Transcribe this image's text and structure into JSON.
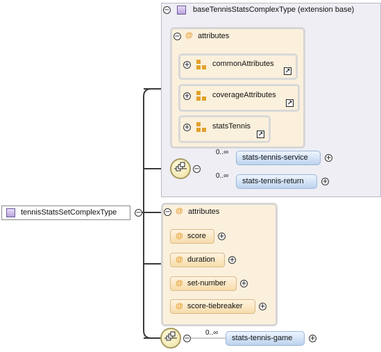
{
  "root": {
    "label": "tennisStatsSetComplexType"
  },
  "extension": {
    "label": "baseTennisStatsComplexType (extension base)",
    "attributes_label": "attributes",
    "groups": [
      {
        "label": "commonAttributes"
      },
      {
        "label": "coverageAttributes"
      },
      {
        "label": "statsTennis"
      }
    ],
    "sequence": [
      {
        "label": "stats-tennis-service",
        "card": "0..∞"
      },
      {
        "label": "stats-tennis-return",
        "card": "0..∞"
      }
    ]
  },
  "attributes": {
    "label": "attributes",
    "items": [
      {
        "label": "score"
      },
      {
        "label": "duration"
      },
      {
        "label": "set-number"
      },
      {
        "label": "score-tiebreaker"
      }
    ]
  },
  "sequence": [
    {
      "label": "stats-tennis-game",
      "card": "0..∞"
    }
  ],
  "symbols": {
    "at": "@",
    "collapse": "−",
    "expand": "+"
  },
  "colors": {
    "attribute_accent": "#e49a2a",
    "element_fill": "#bcd3ee",
    "type_icon": "#b9a3dc"
  }
}
